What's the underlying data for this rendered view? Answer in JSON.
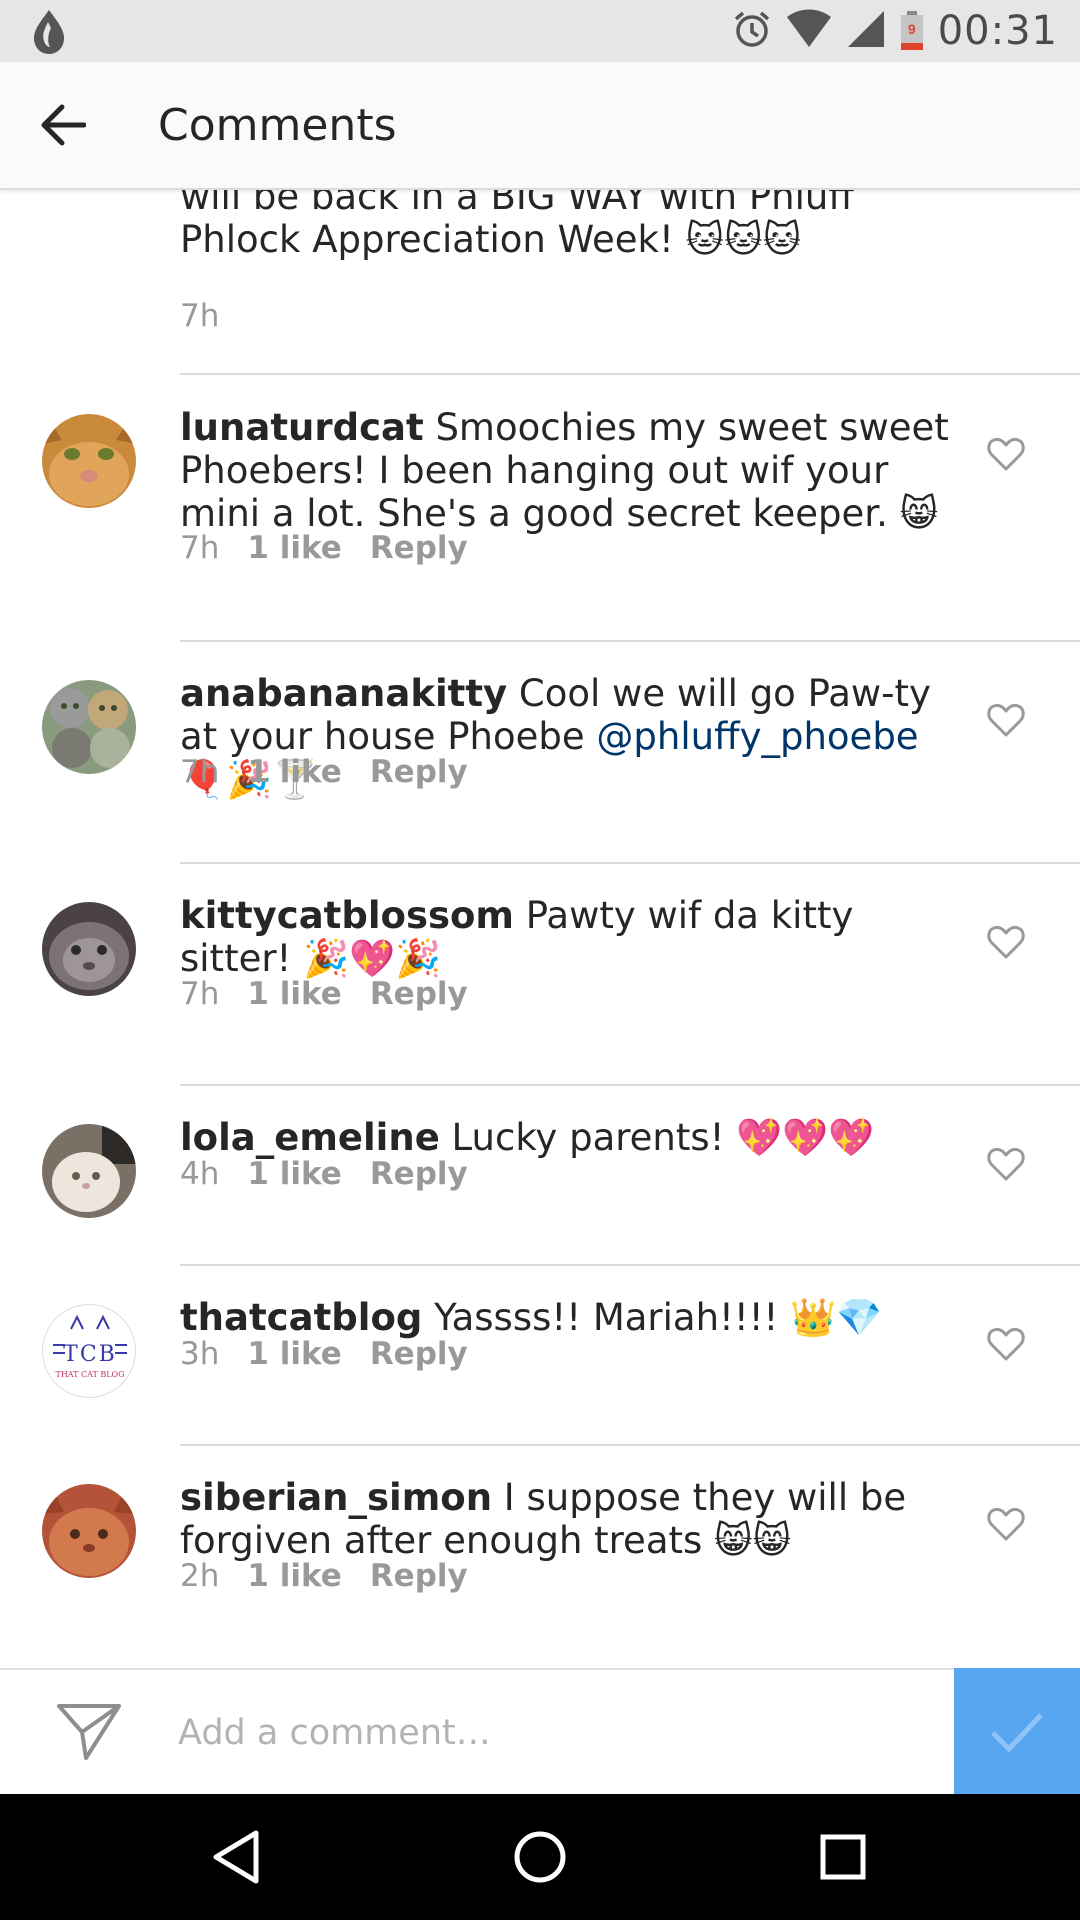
{
  "status_bar": {
    "time": "00:31",
    "battery_level": "9",
    "icons": [
      "app-notification-icon",
      "alarm-icon",
      "wifi-icon",
      "signal-icon",
      "battery-icon"
    ]
  },
  "header": {
    "title": "Comments",
    "back_icon": "arrow-back-icon"
  },
  "partial_comment": {
    "text": "will be back in a BIG WAY with Phluff Phlock Appreciation Week! 🐱🐱🐱",
    "time": "7h"
  },
  "comments": [
    {
      "username": "lunaturdcat",
      "text": " Smoochies my sweet sweet Phoebers! I been hanging out wif your mini a lot. She's a good secret keeper. 😸",
      "mention": "",
      "text_after": "",
      "time": "7h",
      "likes": "1 like",
      "reply": "Reply",
      "avatar_color": "#c98a3c"
    },
    {
      "username": "anabananakitty",
      "text": " Cool we will go Paw-ty at your house Phoebe ",
      "mention": "@phluffy_phoebe",
      "text_after": " 🎈🎉🍸",
      "time": "7h",
      "likes": "1 like",
      "reply": "Reply",
      "avatar_color": "#8a9a7e"
    },
    {
      "username": "kittycatblossom",
      "text": " Pawty wif da kitty sitter! 🎉💖🎉",
      "mention": "",
      "text_after": "",
      "time": "7h",
      "likes": "1 like",
      "reply": "Reply",
      "avatar_color": "#4a4246"
    },
    {
      "username": "lola_emeline",
      "text": " Lucky parents! 💖💖💖",
      "mention": "",
      "text_after": "",
      "time": "4h",
      "likes": "1 like",
      "reply": "Reply",
      "avatar_color": "#d9d2c6"
    },
    {
      "username": "thatcatblog",
      "text": " Yassss!! Mariah!!!! 👑💎",
      "mention": "",
      "text_after": "",
      "time": "3h",
      "likes": "1 like",
      "reply": "Reply",
      "avatar_color": "#ffffff"
    },
    {
      "username": "siberian_simon",
      "text": " I suppose they will be forgiven after enough treats 😸😸",
      "mention": "",
      "text_after": "",
      "time": "2h",
      "likes": "1 like",
      "reply": "Reply",
      "avatar_color": "#b5533a"
    }
  ],
  "thatcatblog_logo": {
    "letters": "TCB",
    "caption": "THAT CAT BLOG"
  },
  "composer": {
    "placeholder": "Add a comment…",
    "send_icon": "send-icon",
    "post_icon": "checkmark-icon",
    "post_color": "#58a6f0"
  },
  "nav_bar": {
    "icons": [
      "nav-back-icon",
      "nav-home-icon",
      "nav-recents-icon"
    ]
  }
}
